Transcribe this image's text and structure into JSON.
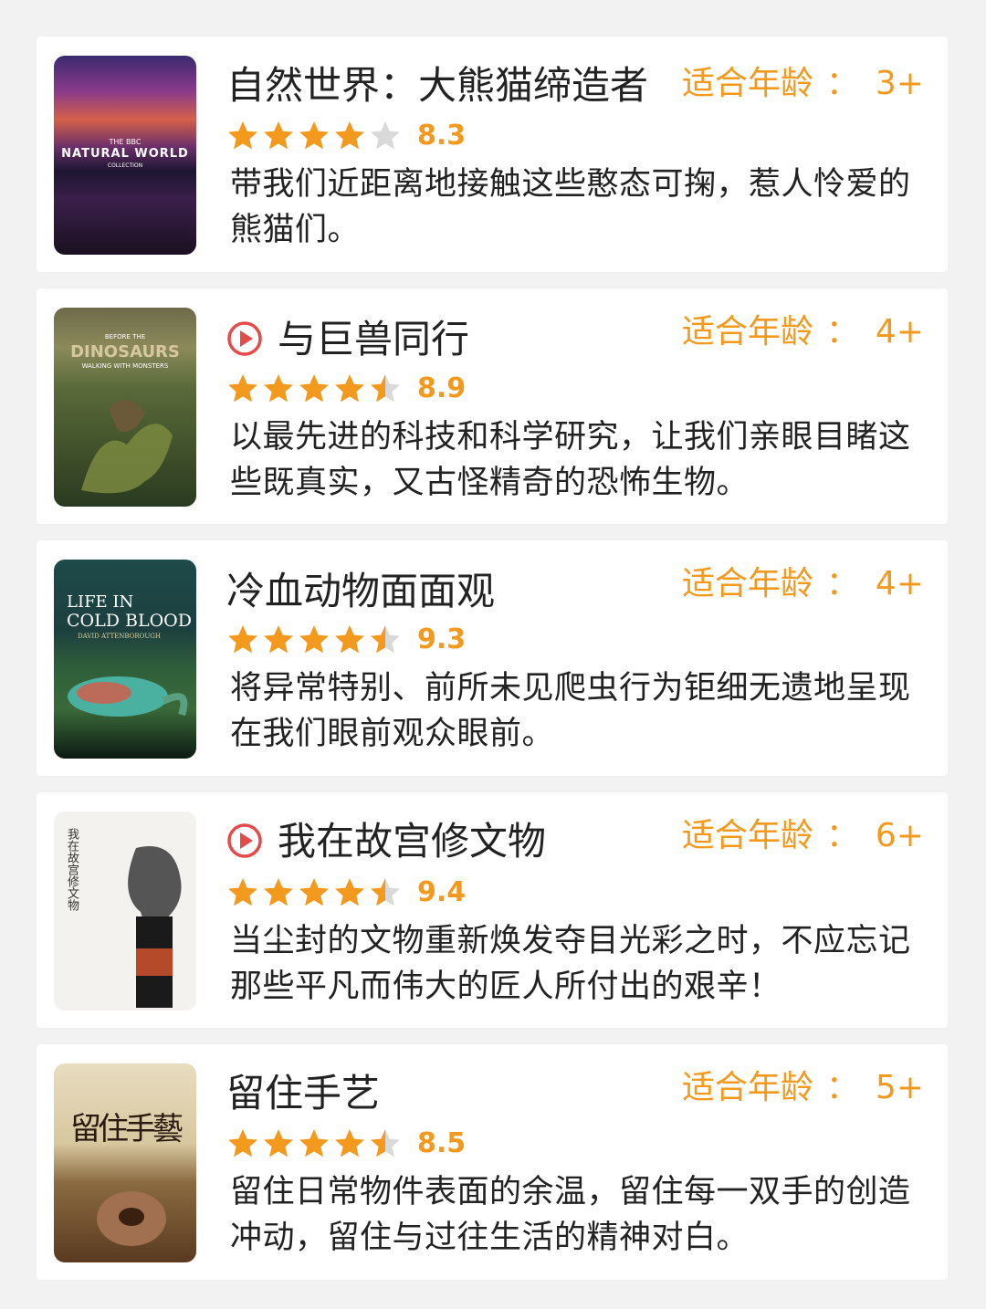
{
  "colors": {
    "accent": "#f39a1e",
    "star_empty": "#d9d9d9",
    "play": "#e44b4b"
  },
  "age_prefix": "适合年龄",
  "age_colon": "：",
  "items": [
    {
      "title": "自然世界：大熊猫缔造者",
      "age": "3+",
      "rating": 8.3,
      "stars": 4,
      "score": "8.3",
      "desc": "带我们近距离地接触这些憨态可掬，惹人怜爱的熊猫们。",
      "has_play": false,
      "poster": {
        "line1": "THE BBC",
        "line2": "NATURAL WORLD",
        "line3": "COLLECTION"
      }
    },
    {
      "title": "与巨兽同行",
      "age": "4+",
      "rating": 8.9,
      "stars": 4.5,
      "score": "8.9",
      "desc": "以最先进的科技和科学研究，让我们亲眼目睹这些既真实，又古怪精奇的恐怖生物。",
      "has_play": true,
      "poster": {
        "line1": "BEFORE THE",
        "line2": "DINOSAURS",
        "line3": "WALKING WITH MONSTERS"
      }
    },
    {
      "title": "冷血动物面面观",
      "age": "4+",
      "rating": 9.3,
      "stars": 4.5,
      "score": "9.3",
      "desc": "将异常特别、前所未见爬虫行为钜细无遗地呈现在我们眼前观众眼前。",
      "has_play": false,
      "poster": {
        "line1": "LIFE IN",
        "line2": "COLD BLOOD",
        "line3": "DAVID ATTENBOROUGH"
      }
    },
    {
      "title": "我在故宫修文物",
      "age": "6+",
      "rating": 9.4,
      "stars": 4.5,
      "score": "9.4",
      "desc": "当尘封的文物重新焕发夺目光彩之时，不应忘记那些平凡而伟大的匠人所付出的艰辛！",
      "has_play": true,
      "poster": {
        "line1": "我在故宫修文物",
        "line2": "",
        "line3": ""
      }
    },
    {
      "title": "留住手艺",
      "age": "5+",
      "rating": 8.5,
      "stars": 4.5,
      "score": "8.5",
      "desc": "留住日常物件表面的余温，留住每一双手的创造冲动，留住与过往生活的精神对白。",
      "has_play": false,
      "poster": {
        "line1": "留住手藝",
        "line2": "",
        "line3": ""
      }
    }
  ]
}
